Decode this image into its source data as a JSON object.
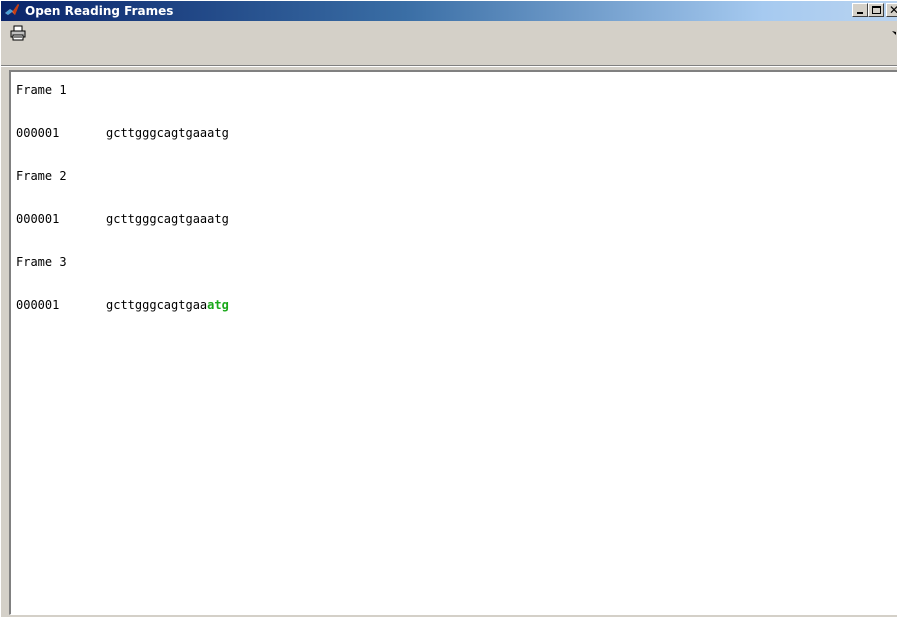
{
  "window": {
    "title": "Open Reading Frames"
  },
  "toolbar": {
    "print_icon": "printer-icon"
  },
  "frames": [
    {
      "label": "Frame 1",
      "index": "000001",
      "sequence": "gcttgggcagtgaaatg",
      "highlight": ""
    },
    {
      "label": "Frame 2",
      "index": "000001",
      "sequence": "gcttgggcagtgaaatg",
      "highlight": ""
    },
    {
      "label": "Frame 3",
      "index": "000001",
      "sequence": "gcttgggcagtgaa",
      "highlight": "atg"
    }
  ],
  "colors": {
    "highlight": "#1aa81a",
    "title_bar_start": "#0a246a",
    "title_bar_end": "#b9d3f0"
  }
}
